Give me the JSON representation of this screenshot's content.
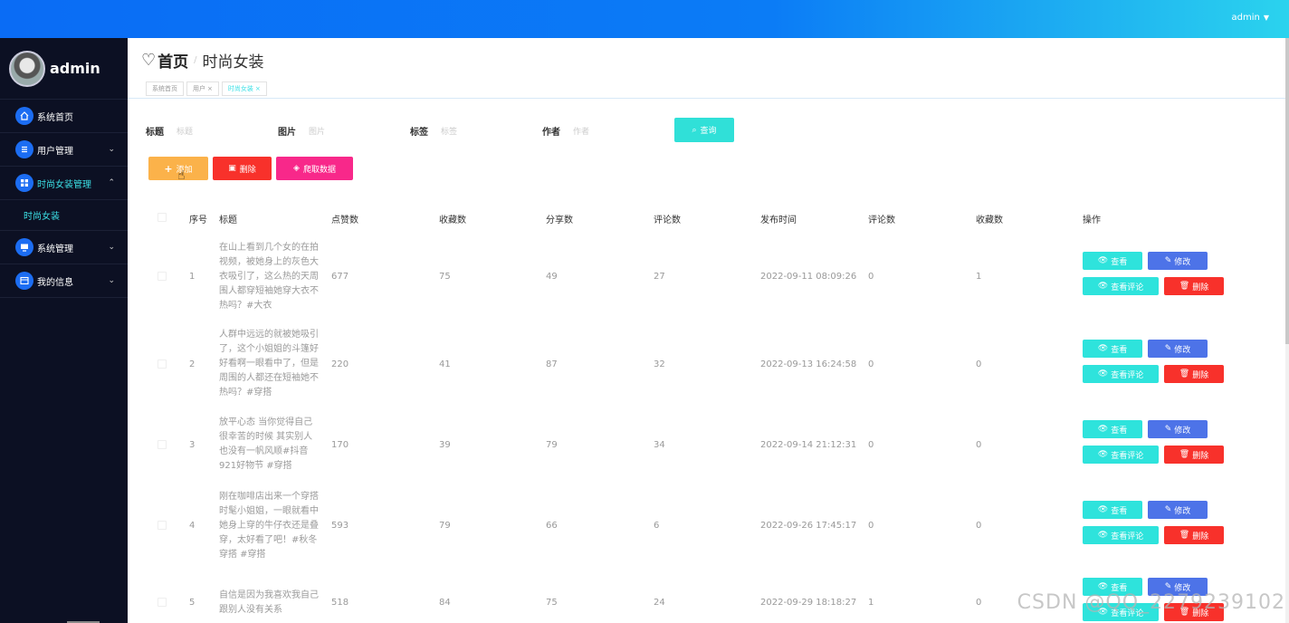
{
  "topbar": {
    "user": "admin"
  },
  "sidebar": {
    "brand": "admin",
    "items": [
      {
        "label": "系统首页",
        "icon": "home-icon"
      },
      {
        "label": "用户管理",
        "icon": "list-icon"
      },
      {
        "label": "时尚女装管理",
        "icon": "grid-icon"
      },
      {
        "label": "系统管理",
        "icon": "monitor-icon"
      },
      {
        "label": "我的信息",
        "icon": "card-icon"
      }
    ],
    "sub_item": "时尚女装"
  },
  "header": {
    "home": "首页",
    "current": "时尚女装",
    "tags": [
      "系统首页",
      "用户",
      "时尚女装"
    ]
  },
  "search": {
    "fields": [
      {
        "label": "标题",
        "placeholder": "标题"
      },
      {
        "label": "图片",
        "placeholder": "图片"
      },
      {
        "label": "标签",
        "placeholder": "标签"
      },
      {
        "label": "作者",
        "placeholder": "作者"
      }
    ],
    "query_label": "查询"
  },
  "toolbar": {
    "add_label": "添加",
    "delete_label": "删除",
    "crawl_label": "爬取数据"
  },
  "table": {
    "columns": [
      "序号",
      "标题",
      "点赞数",
      "收藏数",
      "分享数",
      "评论数",
      "发布时间",
      "评论数",
      "收藏数",
      "操作"
    ],
    "rows": [
      {
        "no": "1",
        "title": "在山上看到几个女的在拍视频，被她身上的灰色大衣吸引了，这么热的天周围人都穿短袖她穿大衣不热吗？#大衣",
        "likes": "677",
        "favs": "75",
        "shares": "49",
        "comments": "27",
        "time": "2022-09-11 08:09:26",
        "c2": "0",
        "f2": "1"
      },
      {
        "no": "2",
        "title": "人群中远远的就被她吸引了，这个小姐姐的斗篷好好看啊一眼看中了，但是周围的人都还在短袖她不热吗？#穿搭",
        "likes": "220",
        "favs": "41",
        "shares": "87",
        "comments": "32",
        "time": "2022-09-13 16:24:58",
        "c2": "0",
        "f2": "0"
      },
      {
        "no": "3",
        "title": "放平心态 当你觉得自己很幸苦的时候 其实别人也没有一帆风顺#抖音921好物节 #穿搭",
        "likes": "170",
        "favs": "39",
        "shares": "79",
        "comments": "34",
        "time": "2022-09-14 21:12:31",
        "c2": "0",
        "f2": "0"
      },
      {
        "no": "4",
        "title": "刚在咖啡店出来一个穿搭时髦小姐姐，一眼就看中她身上穿的牛仔衣还是叠穿，太好看了吧！#秋冬穿搭 #穿搭",
        "likes": "593",
        "favs": "79",
        "shares": "66",
        "comments": "6",
        "time": "2022-09-26 17:45:17",
        "c2": "0",
        "f2": "0"
      },
      {
        "no": "5",
        "title": "自信是因为我喜欢我自己跟别人没有关系",
        "likes": "518",
        "favs": "84",
        "shares": "75",
        "comments": "24",
        "time": "2022-09-29 18:18:27",
        "c2": "1",
        "f2": "0"
      }
    ],
    "actions": {
      "view": "查看",
      "edit": "修改",
      "comments": "查看评论",
      "delete": "删除"
    }
  },
  "watermark": "CSDN @QQ_2279239102"
}
